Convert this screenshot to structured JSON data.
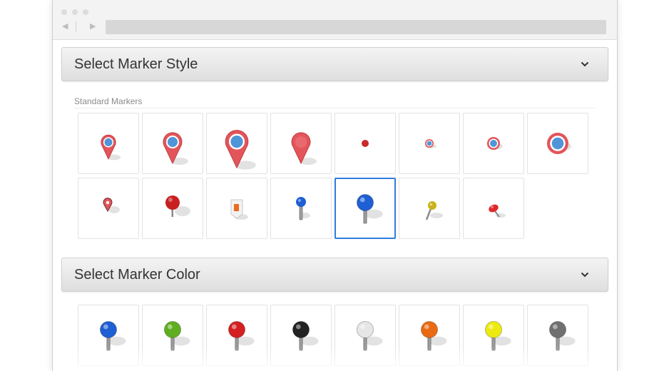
{
  "style_panel": {
    "title": "Select Marker Style",
    "section_label": "Standard Markers",
    "markers": [
      {
        "icon": "small-teardrop-pin-icon",
        "selected": false
      },
      {
        "icon": "medium-teardrop-pin-icon",
        "selected": false
      },
      {
        "icon": "large-teardrop-pin-icon",
        "selected": false
      },
      {
        "icon": "solid-teardrop-pin-icon",
        "selected": false
      },
      {
        "icon": "small-dot-icon",
        "selected": false
      },
      {
        "icon": "small-ring-icon",
        "selected": false
      },
      {
        "icon": "medium-ring-icon",
        "selected": false
      },
      {
        "icon": "large-ring-icon",
        "selected": false
      },
      {
        "icon": "tiny-pin-with-shadow-icon",
        "selected": false
      },
      {
        "icon": "red-map-pin-icon",
        "selected": false
      },
      {
        "icon": "flag-marker-icon",
        "selected": false
      },
      {
        "icon": "thin-pushpin-icon",
        "selected": false
      },
      {
        "icon": "blue-pushpin-icon",
        "selected": true
      },
      {
        "icon": "angled-pushpin-icon",
        "selected": false
      },
      {
        "icon": "thumbtack-icon",
        "selected": false
      }
    ]
  },
  "color_panel": {
    "title": "Select Marker Color",
    "colors": [
      {
        "name": "blue",
        "hex": "#1f5fd4"
      },
      {
        "name": "green",
        "hex": "#5fae20"
      },
      {
        "name": "red",
        "hex": "#d42020"
      },
      {
        "name": "black",
        "hex": "#222222"
      },
      {
        "name": "white",
        "hex": "#e6e6e6"
      },
      {
        "name": "orange",
        "hex": "#ea6a12"
      },
      {
        "name": "yellow",
        "hex": "#ecea10"
      },
      {
        "name": "gray",
        "hex": "#707070"
      }
    ]
  },
  "theme": {
    "selection_border": "#2f7de0",
    "marker_red": "#e2555a",
    "marker_blue": "#4f95d8"
  }
}
